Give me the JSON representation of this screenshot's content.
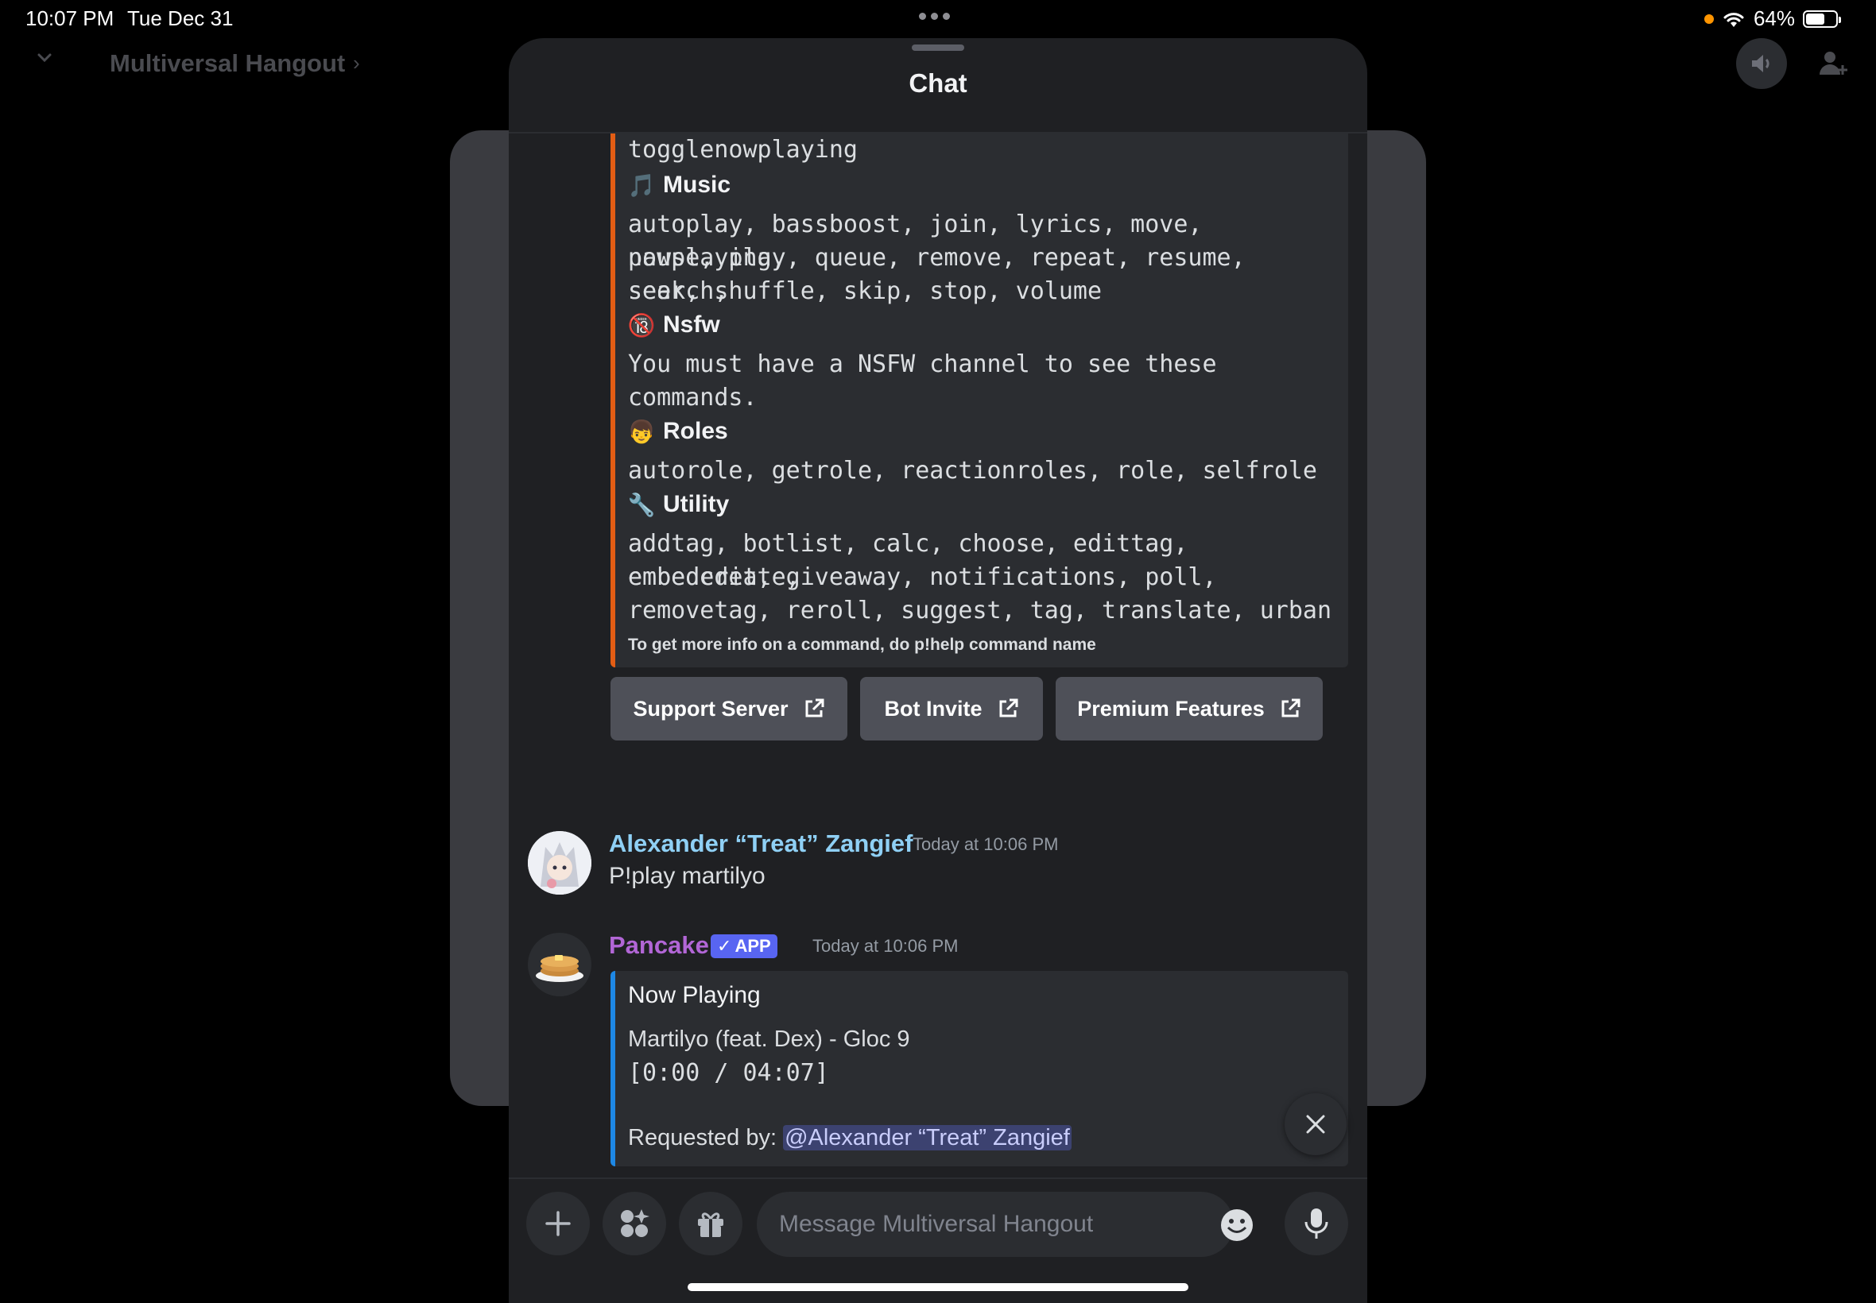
{
  "status_bar": {
    "time": "10:07 PM",
    "date": "Tue Dec 31",
    "battery": "64%",
    "battery_level": 0.64
  },
  "background": {
    "server_title": "Multiversal Hangout"
  },
  "sheet": {
    "title": "Chat"
  },
  "help_embed": {
    "accent_color": "#e35d14",
    "partial_line": "togglenowplaying",
    "categories": [
      {
        "icon": "musical-note-icon",
        "glyph": "🎵",
        "name": "Music",
        "lines": [
          "autoplay, bassboost, join, lyrics, move, nowplaying,",
          "pause, play, queue, remove, repeat, resume, search,",
          "seek, shuffle, skip, stop, volume"
        ]
      },
      {
        "icon": "no-under-18-icon",
        "glyph": "🔞",
        "name": "Nsfw",
        "lines": [
          "You must have a NSFW channel to see these",
          "commands."
        ]
      },
      {
        "icon": "person-icon",
        "glyph": "👦",
        "name": "Roles",
        "lines": [
          "autorole, getrole, reactionroles, role, selfrole"
        ]
      },
      {
        "icon": "wrench-icon",
        "glyph": "🔧",
        "name": "Utility",
        "lines": [
          "addtag, botlist, calc, choose, edittag, embedcreate,",
          "embededit, giveaway, notifications, poll,",
          "removetag, reroll, suggest, tag, translate, urban"
        ]
      }
    ],
    "footer": "To get more info on a command, do p!help command name"
  },
  "link_buttons": {
    "support": "Support Server",
    "invite": "Bot Invite",
    "premium": "Premium Features"
  },
  "message1": {
    "author": "Alexander “Treat” Zangief",
    "author_color": "#8fd0f5",
    "timestamp": "Today at 10:06 PM",
    "text": "P!play martilyo"
  },
  "message2": {
    "author": "Pancake",
    "author_color": "#b266d6",
    "badge": "APP",
    "timestamp": "Today at 10:06 PM",
    "embed": {
      "accent_color": "#1e88e5",
      "title": "Now Playing",
      "song": "Martilyo (feat. Dex) - Gloc 9",
      "progress": "[0:00 / 04:07]",
      "requested_label": "Requested by:",
      "mention": "@Alexander “Treat” Zangief"
    }
  },
  "composer": {
    "placeholder": "Message Multiversal Hangout"
  }
}
